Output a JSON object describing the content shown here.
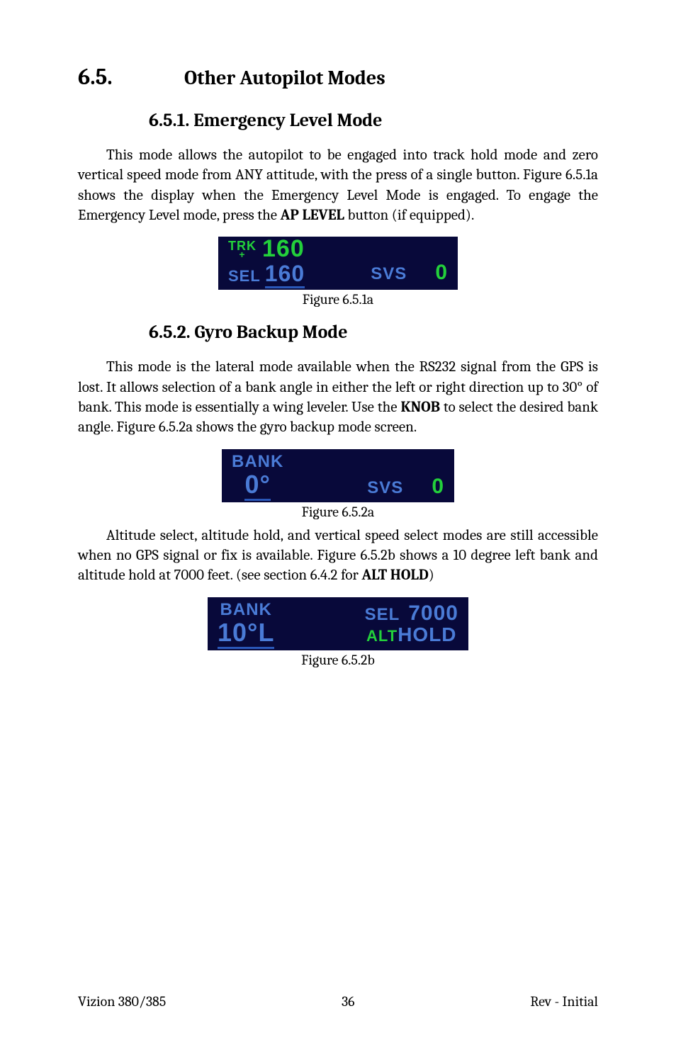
{
  "section": {
    "number": "6.5.",
    "title": "Other Autopilot Modes"
  },
  "sub1": {
    "title": "6.5.1.  Emergency Level Mode",
    "para_before": "This mode allows the autopilot to be engaged into track hold mode and zero vertical speed mode from ANY attitude, with the press of a single button.  Figure 6.5.1a shows the display when the Emergency Level Mode is engaged.   To engage the Emergency Level mode, press the ",
    "para_bold": "AP LEVEL",
    "para_after": " button (if equipped).",
    "fig_caption": "Figure 6.5.1a",
    "lcd": {
      "trk_label": "TRK",
      "trk_value": "160",
      "sel_label": "SEL",
      "sel_value": "160",
      "svs": "SVS",
      "zero": "0"
    }
  },
  "sub2": {
    "title": "6.5.2.  Gyro Backup Mode",
    "para1_before": "This mode is the lateral mode available when the RS232 signal from the GPS is lost.  It allows selection of a bank angle in either the left or right direction up to 30° of bank.  This mode is essentially a wing leveler.  Use the ",
    "para1_bold": "KNOB",
    "para1_after": " to select the desired bank angle.  Figure 6.5.2a shows the gyro backup mode screen.",
    "fig2a_caption": "Figure 6.5.2a",
    "lcd2a": {
      "bank": "BANK",
      "value": "0°",
      "svs": "SVS",
      "zero": "0"
    },
    "para2_a": "Altitude select, altitude hold, and vertical speed select modes are still accessible when no GPS signal or fix is available.  Figure 6.5.2b shows a 10 degree left bank and altitude hold at 7000 feet. (see section 6.4.2 for ",
    "para2_bold": "ALT HOLD",
    "para2_b": ")",
    "fig2b_caption": "Figure 6.5.2b",
    "lcd2b": {
      "bank": "BANK",
      "value": "10°L",
      "sel": "SEL",
      "sel_value": "7000",
      "alt": "ALT",
      "hold": "HOLD"
    }
  },
  "footer": {
    "left": "Vizion 380/385",
    "center": "36",
    "right": "Rev - Initial"
  }
}
